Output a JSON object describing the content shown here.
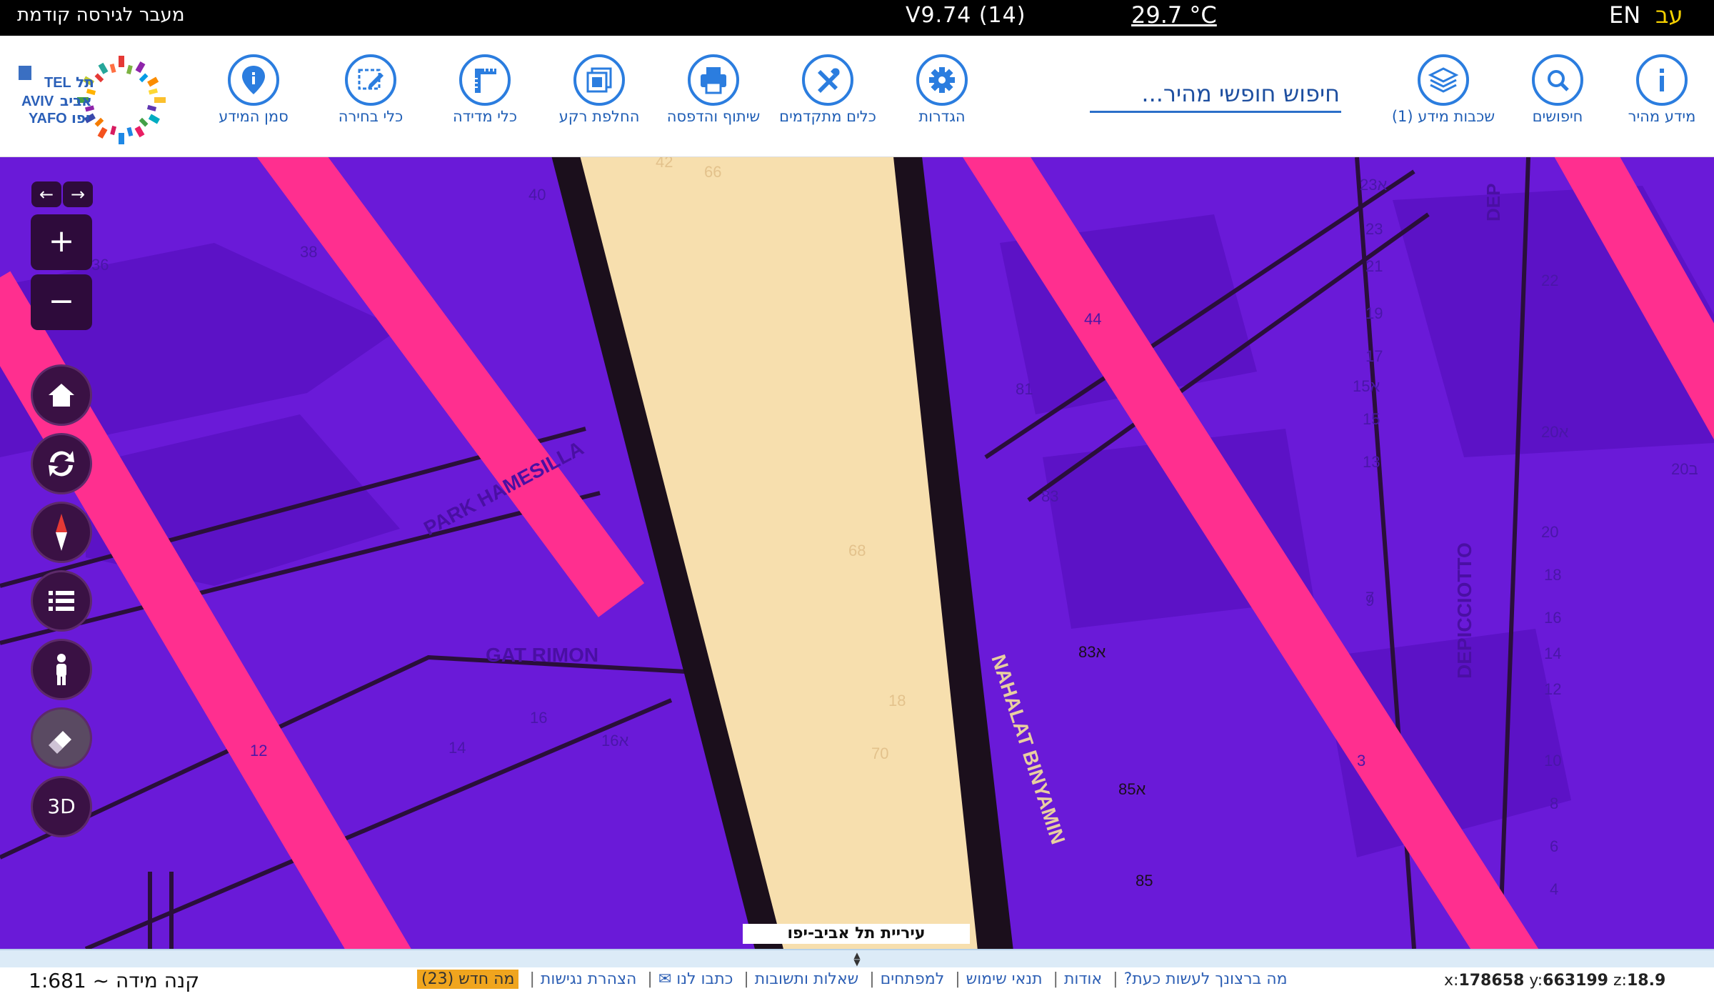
{
  "topbar": {
    "prev_version": "מעבר לגירסה קודמת",
    "version": "V9.74 (14)",
    "temperature": "29.7 °C",
    "lang_en": "EN",
    "lang_he": "עב"
  },
  "logo": {
    "text_en_1": "TEL",
    "text_en_2": "AVIV",
    "text_en_3": "YAFO",
    "text_he_1": "תל",
    "text_he_2": "אביב",
    "text_he_3": "יפו"
  },
  "toolbar": {
    "tools": [
      {
        "label": "סמן המידע",
        "icon": "location-pin-icon"
      },
      {
        "label": "כלי בחירה",
        "icon": "selection-icon"
      },
      {
        "label": "כלי מדידה",
        "icon": "ruler-icon"
      },
      {
        "label": "החלפת רקע",
        "icon": "layers-square-icon"
      },
      {
        "label": "שיתוף והדפסה",
        "icon": "printer-icon"
      },
      {
        "label": "כלים מתקדמים",
        "icon": "tools-icon"
      },
      {
        "label": "הגדרות",
        "icon": "gear-icon"
      },
      {
        "label": "שכבות מידע (1)",
        "icon": "stack-icon"
      },
      {
        "label": "חיפושים",
        "icon": "search-icon"
      },
      {
        "label": "מידע מהיר",
        "icon": "info-icon"
      }
    ],
    "search_placeholder": "חיפוש חופשי מהיר..."
  },
  "map": {
    "labels": {
      "park": "PARK HAMESILLA",
      "gat": "GAT RIMON",
      "nahalat": "NAHALAT BINYAMIN",
      "depiccio": "DEPICCIOTTO",
      "dep": "DEP"
    },
    "house_numbers": [
      "42",
      "66",
      "40",
      "38",
      "36",
      "68",
      "18",
      "70",
      "16",
      "16א",
      "12",
      "14",
      "81",
      "83",
      "83א",
      "85א",
      "85",
      "23א",
      "23",
      "21",
      "19",
      "17",
      "15א",
      "15",
      "13",
      "9",
      "7",
      "22",
      "20א",
      "20ב",
      "20",
      "18",
      "16",
      "14",
      "12",
      "10",
      "8",
      "6",
      "4",
      "3",
      "44"
    ],
    "attribution": "עיריית תל אביב-יפו",
    "colors": {
      "background": "#6a1ad8",
      "pink": "#ff2f8f",
      "street": "#f7dfae",
      "outline": "#1b0f1c"
    },
    "controls": {
      "zoom_in": "+",
      "zoom_out": "−",
      "three_d": "3D",
      "back_arrow": "←",
      "forward_arrow": "→"
    }
  },
  "bottom": {
    "scale": "קנה מידה ~ 1:681",
    "links": [
      "מה ברצונך לעשות כעת?",
      "אודות",
      "תנאי שימוש",
      "למפתחים",
      "שאלות ותשובות",
      "כתבו לנו ✉",
      "הצהרת נגישות"
    ],
    "whats_new": "מה חדש (23)",
    "coords": {
      "x_label": "x:",
      "x": "178658",
      "y_label": "y:",
      "y": "663199",
      "z_label": "z:",
      "z": "18.9"
    }
  }
}
